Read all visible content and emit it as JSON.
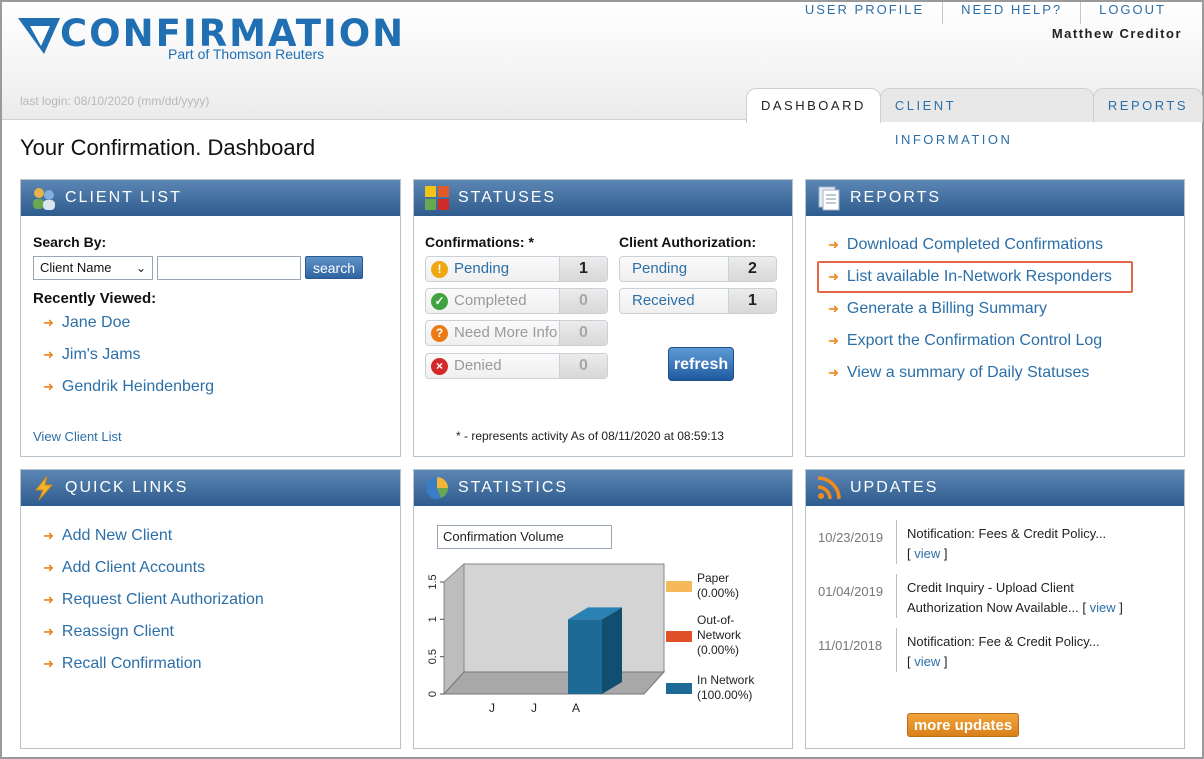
{
  "app": {
    "logo_text": "CONFIRMATION",
    "logo_sub": "Part of Thomson Reuters",
    "last_login": "last login: 08/10/2020 (mm/dd/yyyy)"
  },
  "topnav": [
    "USER PROFILE",
    "NEED HELP?",
    "LOGOUT"
  ],
  "user_name": "Matthew Creditor",
  "tabs": [
    "DASHBOARD",
    "CLIENT INFORMATION",
    "REPORTS"
  ],
  "page_title": "Your Confirmation. Dashboard",
  "client_list": {
    "title": "CLIENT LIST",
    "search_by": "Search By:",
    "select_value": "Client Name",
    "search_button": "search",
    "recently_viewed": "Recently Viewed:",
    "recent": [
      "Jane Doe",
      "Jim's Jams",
      "Gendrik Heindenberg"
    ],
    "view_all": "View Client List"
  },
  "statuses": {
    "title": "STATUSES",
    "confirmations_label": "Confirmations: *",
    "client_auth_label": "Client Authorization:",
    "confirmations": [
      {
        "name": "Pending",
        "count": "1",
        "icon": "warning-icon"
      },
      {
        "name": "Completed",
        "count": "0",
        "icon": "check-icon"
      },
      {
        "name": "Need More Info",
        "count": "0",
        "icon": "question-icon"
      },
      {
        "name": "Denied",
        "count": "0",
        "icon": "x-icon"
      }
    ],
    "authorizations": [
      {
        "name": "Pending",
        "count": "2"
      },
      {
        "name": "Received",
        "count": "1"
      }
    ],
    "refresh_button": "refresh",
    "footnote": "* - represents activity As of 08/11/2020 at 08:59:13"
  },
  "reports": {
    "title": "REPORTS",
    "items": [
      "Download Completed Confirmations",
      "List available In-Network Responders",
      "Generate a Billing Summary",
      "Export the Confirmation Control Log",
      "View a summary of Daily Statuses"
    ]
  },
  "quick_links": {
    "title": "QUICK LINKS",
    "items": [
      "Add New Client",
      "Add Client Accounts",
      "Request Client Authorization",
      "Reassign Client",
      "Recall Confirmation"
    ]
  },
  "statistics": {
    "title": "STATISTICS",
    "select_value": "Confirmation Volume",
    "legend": [
      {
        "name": "Paper",
        "pct": "(0.00%)",
        "color": "#f5b95c"
      },
      {
        "name": "Out-of-",
        "name2": "Network",
        "pct": "(0.00%)",
        "color": "#e0512a"
      },
      {
        "name": "In Network",
        "pct": "(100.00%)",
        "color": "#1e6a96"
      }
    ],
    "y_ticks": [
      "0",
      "0.5",
      "1",
      "1.5"
    ],
    "x_ticks": [
      "J",
      "J",
      "A"
    ]
  },
  "chart_data": {
    "type": "bar",
    "categories": [
      "J",
      "J",
      "A"
    ],
    "series": [
      {
        "name": "Paper",
        "values": [
          0,
          0,
          0
        ]
      },
      {
        "name": "Out-of-Network",
        "values": [
          0,
          0,
          0
        ]
      },
      {
        "name": "In Network",
        "values": [
          0,
          0,
          1
        ]
      }
    ],
    "title": "Confirmation Volume",
    "ylim": [
      0,
      1.5
    ]
  },
  "updates": {
    "title": "UPDATES",
    "items": [
      {
        "date": "10/23/2019",
        "line1": "Notification: Fees & Credit Policy...",
        "line2": ""
      },
      {
        "date": "01/04/2019",
        "line1": "Credit Inquiry - Upload Client",
        "line2": "Authorization Now Available..."
      },
      {
        "date": "11/01/2018",
        "line1": "Notification: Fee & Credit Policy...",
        "line2": ""
      }
    ],
    "view_label": "view",
    "more_button": "more updates"
  }
}
